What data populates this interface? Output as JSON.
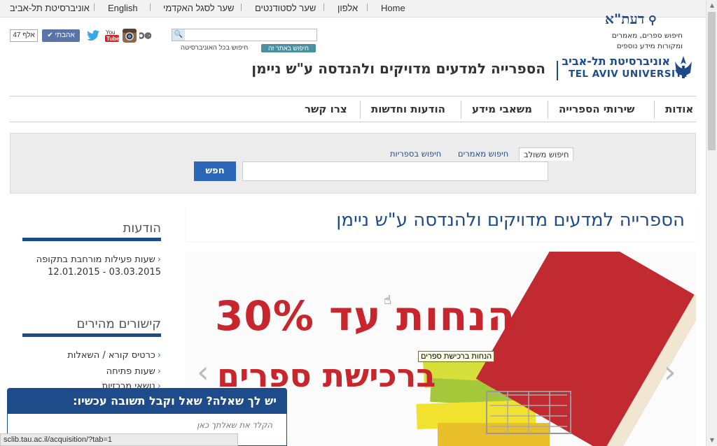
{
  "topbar": {
    "links": [
      "Home",
      "אלפון",
      "שער לסטודנטים",
      "שער לסגל האקדמי",
      "English",
      "אוניברסיטת תל-אביב"
    ]
  },
  "social": {
    "likes": "47 אלף",
    "like_button": "אהבתי",
    "icons": [
      "twitter-icon",
      "youtube-icon",
      "instagram-icon",
      "link-icon"
    ]
  },
  "top_search": {
    "placeholder": "",
    "scope_site": "חיפוש באתר זה",
    "scope_university": "חיפוש בכל האוניברסיטה"
  },
  "logo": {
    "he": "אוניברסיטת תל-אביב",
    "en": "TEL AVIV UNIVERSITY"
  },
  "site_title": "הספרייה למדעים מדויקים ולהנדסה ע\"ש ניימן",
  "nav": [
    "אודות",
    "שירותי הספרייה",
    "משאבי מידע",
    "הודעות וחדשות",
    "צרו קשר"
  ],
  "library_search": {
    "logo": "דעת\"א",
    "description": "חיפוש ספרים, מאמרים ומקורות מידע נוספים",
    "tabs": [
      "חיפוש משולב",
      "חיפוש מאמרים",
      "חיפוש בספריות"
    ],
    "active_tab": "חיפוש משולב",
    "button": "חפש",
    "placeholder": ""
  },
  "sidebar": {
    "announcements_title": "הודעות",
    "announcement": "שעות פעילות מורחבת בתקופה 03.03.2015 - 12.01.2015",
    "quicklinks_title": "קישורים מהירים",
    "quicklinks": [
      "כרטיס קורא / השאלות",
      "שעות פתיחה",
      "נושאי מרכזיות"
    ]
  },
  "page": {
    "heading": "הספרייה למדעים מדויקים ולהנדסה ע\"ש ניימן",
    "banner_line1": "הנחות עד 30%",
    "banner_line2": "ברכישת ספרים",
    "tooltip": "הנחות ברכישת ספרים"
  },
  "chat": {
    "header": "יש לך שאלה? שאל וקבל תשובה עכשיו:",
    "placeholder": "הקלד את שאלתך כאן"
  },
  "status_url": "sclib.tau.ac.il/acquisition/?tab=1",
  "colors": {
    "brand_blue": "#1e4c8a",
    "accent_red": "#c7262c",
    "button_blue": "#2c66b8"
  }
}
